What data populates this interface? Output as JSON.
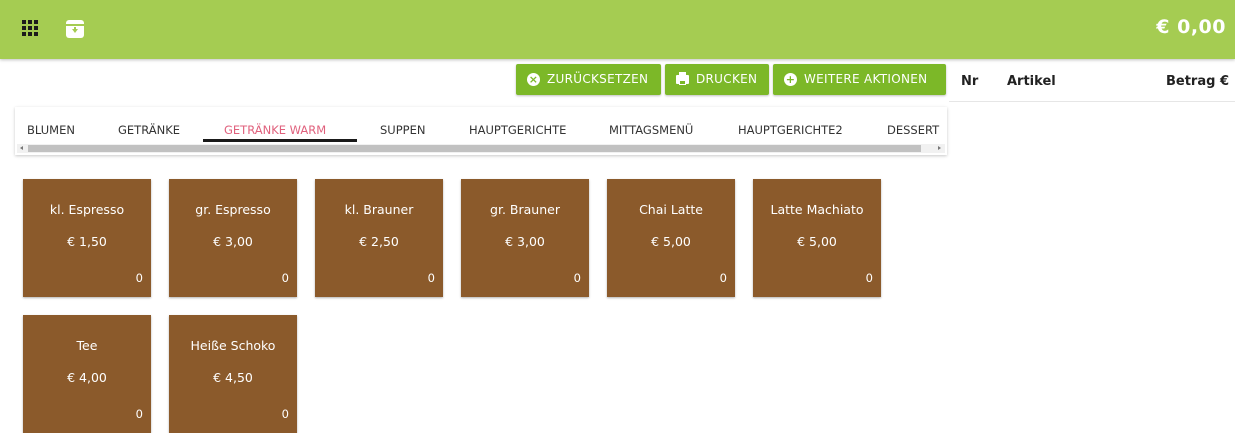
{
  "topbar": {
    "total": "€ 0,00",
    "icons": [
      "apps-grid-icon",
      "archive-box-icon"
    ],
    "color": "#a5cc52"
  },
  "actions": {
    "reset_label": "ZURÜCKSETZEN",
    "print_label": "DRUCKEN",
    "more_label": "WEITERE AKTIONEN",
    "color": "#7cb828"
  },
  "order_table": {
    "columns": [
      "Nr",
      "Artikel",
      "Betrag €"
    ]
  },
  "tabs": [
    {
      "label": "BLUMEN"
    },
    {
      "label": "GETRÄNKE"
    },
    {
      "label": "GETRÄNKE WARM",
      "active": true
    },
    {
      "label": "SUPPEN"
    },
    {
      "label": "HAUPTGERICHTE"
    },
    {
      "label": "MITTAGSMENÜ"
    },
    {
      "label": "HAUPTGERICHTE2"
    },
    {
      "label": "DESSERT"
    }
  ],
  "active_tab_color": "#e0617d",
  "products": [
    {
      "name": "kl. Espresso",
      "price": "€ 1,50",
      "count": "0"
    },
    {
      "name": "gr. Espresso",
      "price": "€ 3,00",
      "count": "0"
    },
    {
      "name": "kl. Brauner",
      "price": "€ 2,50",
      "count": "0"
    },
    {
      "name": "gr. Brauner",
      "price": "€ 3,00",
      "count": "0"
    },
    {
      "name": "Chai Latte",
      "price": "€ 5,00",
      "count": "0"
    },
    {
      "name": "Latte Machiato",
      "price": "€ 5,00",
      "count": "0"
    },
    {
      "name": "Tee",
      "price": "€ 4,00",
      "count": "0"
    },
    {
      "name": "Heiße Schoko",
      "price": "€ 4,50",
      "count": "0"
    }
  ],
  "tile_color": "#8b5a2b"
}
